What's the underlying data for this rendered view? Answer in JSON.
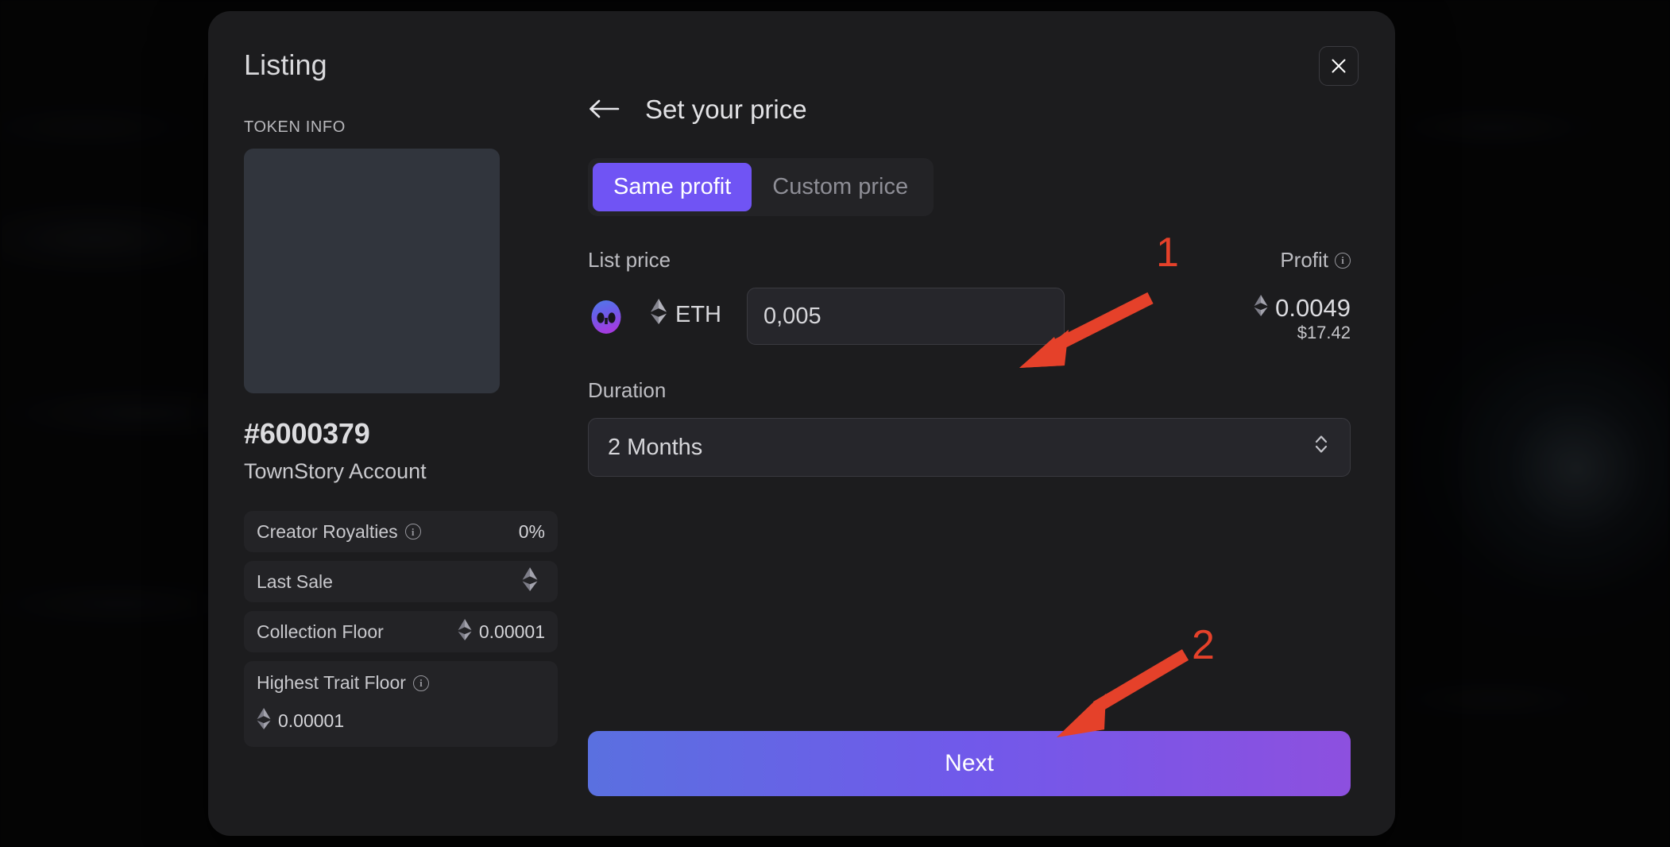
{
  "modal": {
    "title": "Listing",
    "close_icon": "close-icon"
  },
  "token_info": {
    "section_label": "TOKEN INFO",
    "image_placeholder": "token-image-placeholder",
    "token_id": "#6000379",
    "collection_name": "TownStory Account",
    "stats": [
      {
        "label": "Creator Royalties",
        "has_info": true,
        "value": "0%",
        "has_eth_icon": false,
        "wrap": false
      },
      {
        "label": "Last Sale",
        "has_info": false,
        "value": "",
        "has_eth_icon": true,
        "wrap": false
      },
      {
        "label": "Collection Floor",
        "has_info": false,
        "value": "0.00001",
        "has_eth_icon": true,
        "wrap": false
      },
      {
        "label": "Highest Trait Floor",
        "has_info": true,
        "value": "0.00001",
        "has_eth_icon": true,
        "wrap": true
      }
    ]
  },
  "price_step": {
    "back_icon": "arrow-left-icon",
    "title": "Set your price",
    "tabs": [
      {
        "label": "Same profit",
        "active": true
      },
      {
        "label": "Custom price",
        "active": false
      }
    ],
    "list_price_label": "List price",
    "profit_label": "Profit",
    "currency": "ETH",
    "price_value": "0,005",
    "price_placeholder": "0",
    "profit_eth": "0.0049",
    "profit_usd": "$17.42",
    "duration_label": "Duration",
    "duration_value": "2 Months",
    "duration_chevron_icon": "chevron-up-down-icon",
    "next_label": "Next"
  },
  "annotations": [
    {
      "number": "1",
      "color": "#E5412A"
    },
    {
      "number": "2",
      "color": "#E5412A"
    }
  ],
  "colors": {
    "accent_purple": "#7054F4",
    "cta_gradient_start": "#5A70E0",
    "cta_gradient_end": "#8D50DF",
    "modal_bg": "#1C1C1E",
    "annotation_red": "#E5412A"
  }
}
